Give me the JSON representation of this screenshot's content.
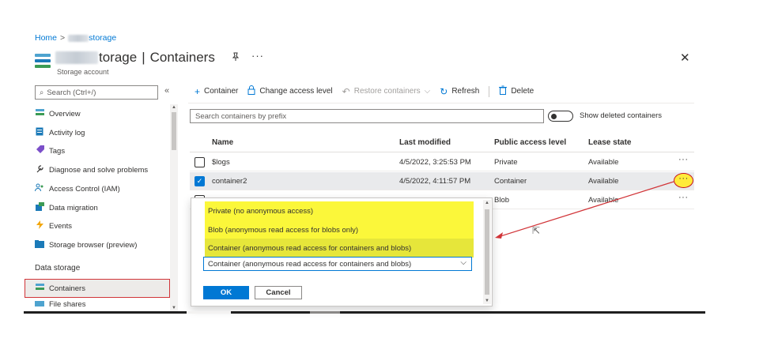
{
  "breadcrumb": {
    "home": "Home",
    "separator": ">",
    "resource": "storage"
  },
  "header": {
    "title_visible": "torage",
    "title_separator": "|",
    "title_page": "Containers",
    "subtitle": "Storage account",
    "pin_icon": "pin-icon",
    "more_icon": "more-icon",
    "close_icon": "close-icon"
  },
  "sidebar": {
    "search_placeholder": "Search (Ctrl+/)",
    "collapse_glyph": "«",
    "items": [
      {
        "label": "Overview",
        "icon": "overview-icon"
      },
      {
        "label": "Activity log",
        "icon": "activity-log-icon"
      },
      {
        "label": "Tags",
        "icon": "tag-icon"
      },
      {
        "label": "Diagnose and solve problems",
        "icon": "wrench-icon"
      },
      {
        "label": "Access Control (IAM)",
        "icon": "people-icon"
      },
      {
        "label": "Data migration",
        "icon": "migration-icon"
      },
      {
        "label": "Events",
        "icon": "lightning-icon"
      },
      {
        "label": "Storage browser (preview)",
        "icon": "folder-icon"
      }
    ],
    "section_label": "Data storage",
    "data_items": [
      {
        "label": "Containers",
        "icon": "containers-icon"
      },
      {
        "label": "File shares",
        "icon": "file-shares-icon"
      }
    ]
  },
  "toolbar": {
    "add_container": "Container",
    "change_access": "Change access level",
    "restore": "Restore containers",
    "refresh": "Refresh",
    "delete": "Delete"
  },
  "filter": {
    "search_placeholder": "Search containers by prefix",
    "toggle_label": "Show deleted containers"
  },
  "table": {
    "columns": [
      "Name",
      "Last modified",
      "Public access level",
      "Lease state"
    ],
    "rows": [
      {
        "name": "$logs",
        "modified": "4/5/2022, 3:25:53 PM",
        "access": "Private",
        "lease": "Available",
        "checked": false
      },
      {
        "name": "container2",
        "modified": "4/5/2022, 4:11:57 PM",
        "access": "Container",
        "lease": "Available",
        "checked": true
      },
      {
        "name": "",
        "modified": "",
        "access": "Blob",
        "lease": "Available",
        "checked": false
      }
    ],
    "more_glyph": "···"
  },
  "dropdown": {
    "options": [
      "Private (no anonymous access)",
      "Blob (anonymous read access for blobs only)",
      "Container (anonymous read access for containers and blobs)"
    ],
    "selected": "Container (anonymous read access for containers and blobs)",
    "ok_label": "OK",
    "cancel_label": "Cancel"
  },
  "colors": {
    "accent": "#0078d4",
    "highlight": "#fbf73a",
    "annotation": "#d13438"
  }
}
